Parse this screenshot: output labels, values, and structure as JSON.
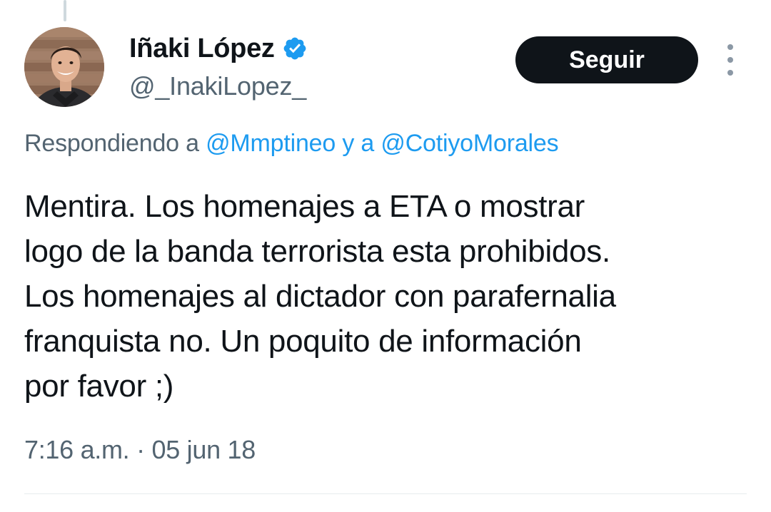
{
  "tweet": {
    "author": {
      "display_name": "Iñaki López",
      "handle": "@_InakiLopez_",
      "verified": true,
      "verified_icon": "verified-badge-icon"
    },
    "follow_label": "Seguir",
    "more_icon": "more-options-icon",
    "replying": {
      "prefix": "Respondiendo a",
      "mention_1": "@Mmptineo",
      "conjunction": "y a",
      "mention_2": "@CotiyoMorales"
    },
    "text_lines": [
      "Mentira. Los homenajes a ETA o mostrar",
      "logo de la banda terrorista esta prohibidos.",
      "Los homenajes al dictador con parafernalia",
      "franquista no. Un poquito de información",
      "por favor ;)"
    ],
    "time": "7:16 a.m.",
    "separator": "·",
    "date": "05 jun 18"
  },
  "colors": {
    "accent": "#1d9bf0",
    "text_primary": "#0f1419",
    "text_secondary": "#536471",
    "button_bg": "#0f1419"
  }
}
